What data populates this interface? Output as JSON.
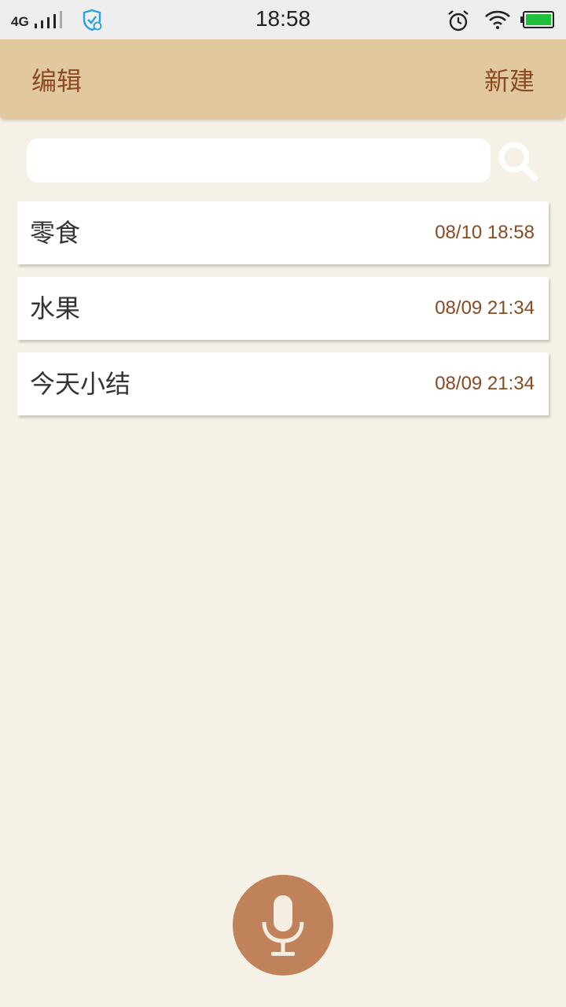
{
  "status_bar": {
    "network": "4G",
    "time": "18:58"
  },
  "header": {
    "edit_label": "编辑",
    "new_label": "新建"
  },
  "search": {
    "placeholder": "",
    "value": ""
  },
  "notes": [
    {
      "title": "零食",
      "date": "08/10 18:58"
    },
    {
      "title": "水果",
      "date": "08/09 21:34"
    },
    {
      "title": "今天小结",
      "date": "08/09 21:34"
    }
  ],
  "colors": {
    "header_bg": "#e2c89f",
    "accent_text": "#8a4a22",
    "background": "#f5f1e6",
    "mic_button": "#bf825a",
    "battery": "#1fbf3a",
    "shield": "#2aa0e0"
  },
  "icons": {
    "signal": "signal-icon",
    "shield": "shield-icon",
    "alarm": "alarm-icon",
    "wifi": "wifi-icon",
    "battery": "battery-icon",
    "search": "search-icon",
    "mic": "microphone-icon"
  }
}
